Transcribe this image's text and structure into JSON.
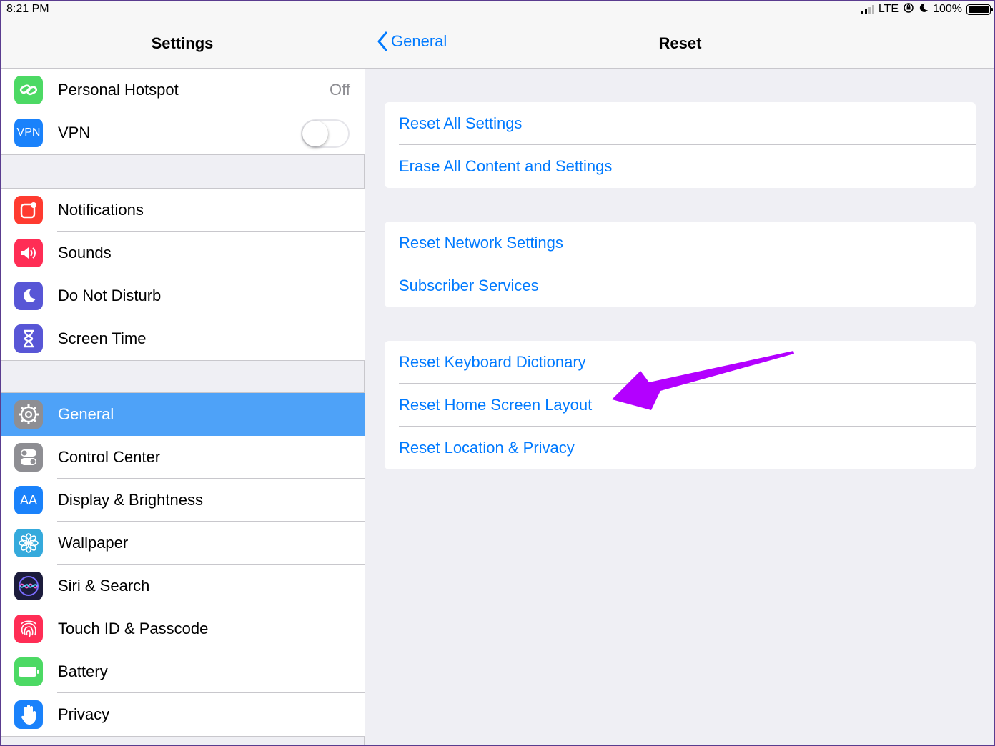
{
  "status_bar": {
    "time": "8:21 PM",
    "carrier": "LTE",
    "battery": "100%"
  },
  "left_panel": {
    "title": "Settings",
    "group1": [
      {
        "label": "Personal Hotspot",
        "value": "Off",
        "icon": "hotspot-icon",
        "color": "#4cd964"
      },
      {
        "label": "VPN",
        "icon": "vpn-icon",
        "icon_text": "VPN",
        "color": "#1a82fb",
        "toggle": false
      }
    ],
    "group2": [
      {
        "label": "Notifications",
        "icon": "notifications-icon",
        "color": "#ff3b30"
      },
      {
        "label": "Sounds",
        "icon": "speaker-icon",
        "color": "#ff2d55"
      },
      {
        "label": "Do Not Disturb",
        "icon": "moon-icon",
        "color": "#5856d6"
      },
      {
        "label": "Screen Time",
        "icon": "hourglass-icon",
        "color": "#5856d6"
      }
    ],
    "group3": [
      {
        "label": "General",
        "icon": "gear-icon",
        "color": "#8e8e93",
        "selected": true
      },
      {
        "label": "Control Center",
        "icon": "switches-icon",
        "color": "#8e8e93"
      },
      {
        "label": "Display & Brightness",
        "icon": "text-size-icon",
        "icon_text": "AA",
        "color": "#1a82fb"
      },
      {
        "label": "Wallpaper",
        "icon": "flower-icon",
        "color": "#35aadc"
      },
      {
        "label": "Siri & Search",
        "icon": "siri-icon",
        "color": "#1c1c3c"
      },
      {
        "label": "Touch ID & Passcode",
        "icon": "fingerprint-icon",
        "color": "#ff2d55"
      },
      {
        "label": "Battery",
        "icon": "battery-icon",
        "color": "#4cd964"
      },
      {
        "label": "Privacy",
        "icon": "hand-icon",
        "color": "#1a82fb"
      }
    ]
  },
  "right_panel": {
    "back_label": "General",
    "title": "Reset",
    "groups": [
      [
        "Reset All Settings",
        "Erase All Content and Settings"
      ],
      [
        "Reset Network Settings",
        "Subscriber Services"
      ],
      [
        "Reset Keyboard Dictionary",
        "Reset Home Screen Layout",
        "Reset Location & Privacy"
      ]
    ]
  },
  "annotation": {
    "arrow_color": "#b300ff"
  },
  "colors": {
    "accent": "#007aff",
    "selected_row": "#4ea2f8",
    "background": "#efeff4"
  }
}
